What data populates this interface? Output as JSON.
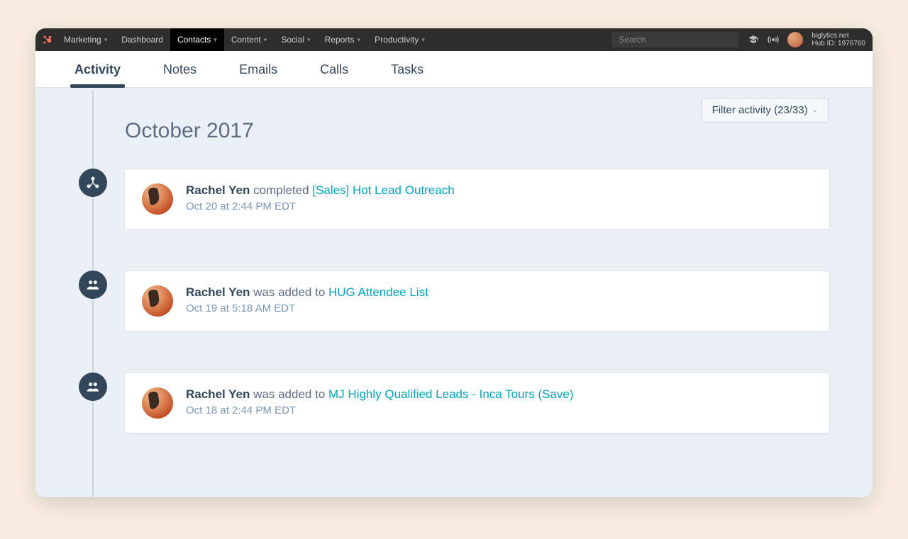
{
  "topnav": {
    "brand": "Marketing",
    "items": [
      {
        "label": "Dashboard",
        "has_caret": false,
        "active": false
      },
      {
        "label": "Contacts",
        "has_caret": true,
        "active": true
      },
      {
        "label": "Content",
        "has_caret": true,
        "active": false
      },
      {
        "label": "Social",
        "has_caret": true,
        "active": false
      },
      {
        "label": "Reports",
        "has_caret": true,
        "active": false
      },
      {
        "label": "Productivity",
        "has_caret": true,
        "active": false
      }
    ],
    "search_placeholder": "Search",
    "account": {
      "domain": "biglytics.net",
      "hubid": "Hub ID: 1976760"
    }
  },
  "tabs": [
    {
      "label": "Activity",
      "active": true
    },
    {
      "label": "Notes",
      "active": false
    },
    {
      "label": "Emails",
      "active": false
    },
    {
      "label": "Calls",
      "active": false
    },
    {
      "label": "Tasks",
      "active": false
    }
  ],
  "filter": {
    "label": "Filter activity (23/33)"
  },
  "timeline": {
    "heading": "October 2017",
    "items": [
      {
        "icon": "workflow",
        "actor": "Rachel Yen",
        "verb": "completed",
        "link": "[Sales] Hot Lead Outreach",
        "timestamp": "Oct 20 at 2:44 PM EDT"
      },
      {
        "icon": "group",
        "actor": "Rachel Yen",
        "verb": "was added to",
        "link": "HUG Attendee List",
        "timestamp": "Oct 19 at 5:18 AM EDT"
      },
      {
        "icon": "group",
        "actor": "Rachel Yen",
        "verb": "was added to",
        "link": "MJ Highly Qualified Leads - Inca Tours (Save)",
        "timestamp": "Oct 18 at 2:44 PM EDT"
      }
    ]
  }
}
